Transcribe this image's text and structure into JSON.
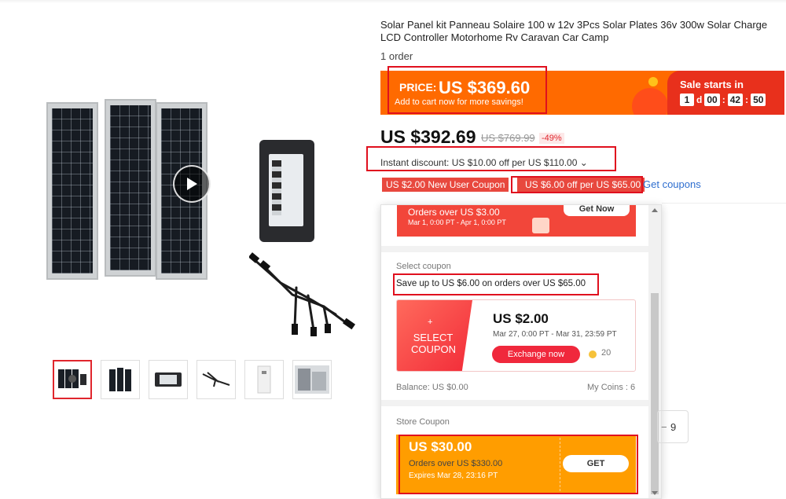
{
  "product": {
    "title": "Solar Panel kit Panneau Solaire 100 w 12v 3Pcs Solar Plates 36v 300w Solar Charge LCD Controller Motorhome Rv Caravan Car Camp",
    "orders": "1 order"
  },
  "promo": {
    "price_label": "PRICE:",
    "price_value": "US $369.60",
    "price_sub": "Add to cart now for more savings!",
    "sale_title": "Sale starts in",
    "timer": {
      "days": "1",
      "d_label": "d",
      "hours": "00",
      "minutes": "42",
      "seconds": "50",
      "sep": ":"
    }
  },
  "pricing": {
    "current": "US $392.69",
    "original": "US $769.99",
    "discount": "-49%",
    "instant_discount": "Instant discount: US $10.00 off per US $110.00 ⌄"
  },
  "coupons": {
    "tag1": "US $2.00 New User Coupon",
    "tag2": "US $6.00 off per US $65.00",
    "get_coupons": "Get coupons"
  },
  "dropdown": {
    "new_user": {
      "line1": "Orders over US $3.00",
      "line2": "Mar 1, 0:00 PT - Apr 1, 0:00 PT",
      "button": "Get Now"
    },
    "select_label": "Select coupon",
    "save_text": "Save up to US $6.00 on orders over US $65.00",
    "card": {
      "plus": "+",
      "select_text": "SELECT COUPON",
      "amount": "US $2.00",
      "dates": "Mar 27, 0:00 PT - Mar 31, 23:59 PT",
      "exchange": "Exchange now",
      "coins": "20"
    },
    "balance": "Balance: US $0.00",
    "my_coins": "My Coins : 6",
    "store_label": "Store Coupon",
    "store": {
      "amount": "US $30.00",
      "orders": "Orders over US $330.00",
      "expires": "Expires Mar 28, 23:16 PT",
      "button": "GET"
    }
  },
  "quantity": {
    "value": "9"
  },
  "colors": {
    "accent_orange": "#ff6a00",
    "accent_red": "#e8301c",
    "highlight_red": "#e0101e",
    "link_blue": "#2e6ecf",
    "store_orange": "#ff9d00"
  }
}
